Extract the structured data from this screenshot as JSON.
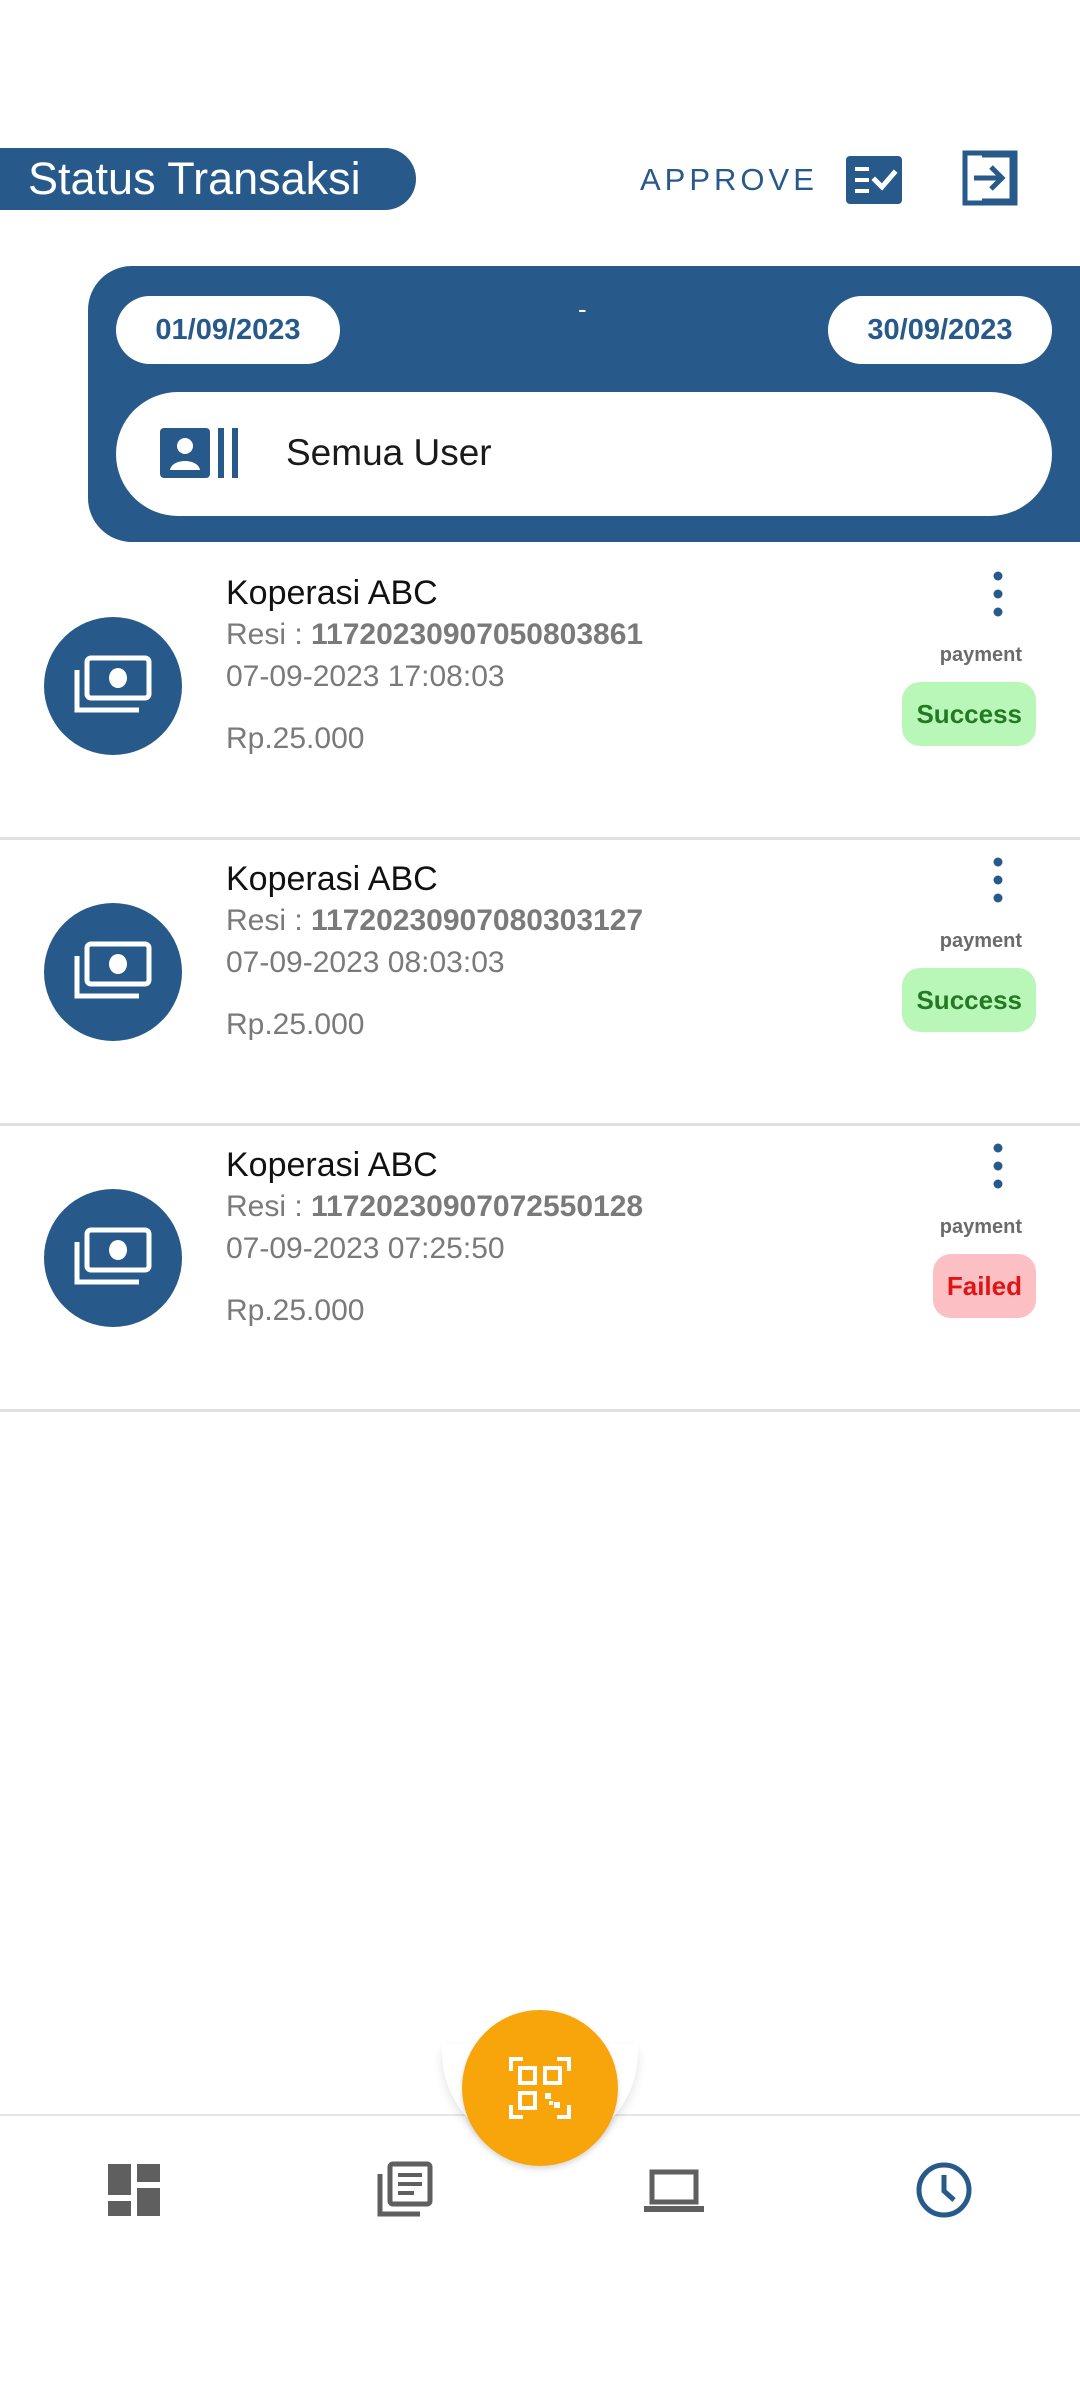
{
  "header": {
    "title": "Status Transaksi",
    "approve_label": "APPROVE",
    "approve_icon": "checklist-icon",
    "logout_icon": "logout-icon"
  },
  "filter": {
    "date_start": "01/09/2023",
    "separator": "-",
    "date_end": "30/09/2023",
    "user_select": "Semua User",
    "user_icon": "user-card-icon"
  },
  "transactions": [
    {
      "name": "Koperasi ABC",
      "resi_label": "Resi : ",
      "resi": "11720230907050803861",
      "datetime": "07-09-2023 17:08:03",
      "amount": "Rp.25.000",
      "type": "payment",
      "status": "Success"
    },
    {
      "name": "Koperasi ABC",
      "resi_label": "Resi : ",
      "resi": "11720230907080303127",
      "datetime": "07-09-2023 08:03:03",
      "amount": "Rp.25.000",
      "type": "payment",
      "status": "Success"
    },
    {
      "name": "Koperasi ABC",
      "resi_label": "Resi : ",
      "resi": "11720230907072550128",
      "datetime": "07-09-2023 07:25:50",
      "amount": "Rp.25.000",
      "type": "payment",
      "status": "Failed"
    }
  ],
  "bottom_nav": {
    "items": [
      "dashboard-icon",
      "reports-icon",
      "devices-icon",
      "history-icon"
    ],
    "active": "history-icon",
    "fab_icon": "qr-scan-icon"
  },
  "colors": {
    "primary": "#275a8a",
    "fab": "#f7a50a",
    "success_bg": "#b9f7b9",
    "success_text": "#237a23",
    "failed_bg": "#fcc0c4",
    "failed_text": "#e01414",
    "nav_inactive": "#5f5f5f"
  }
}
